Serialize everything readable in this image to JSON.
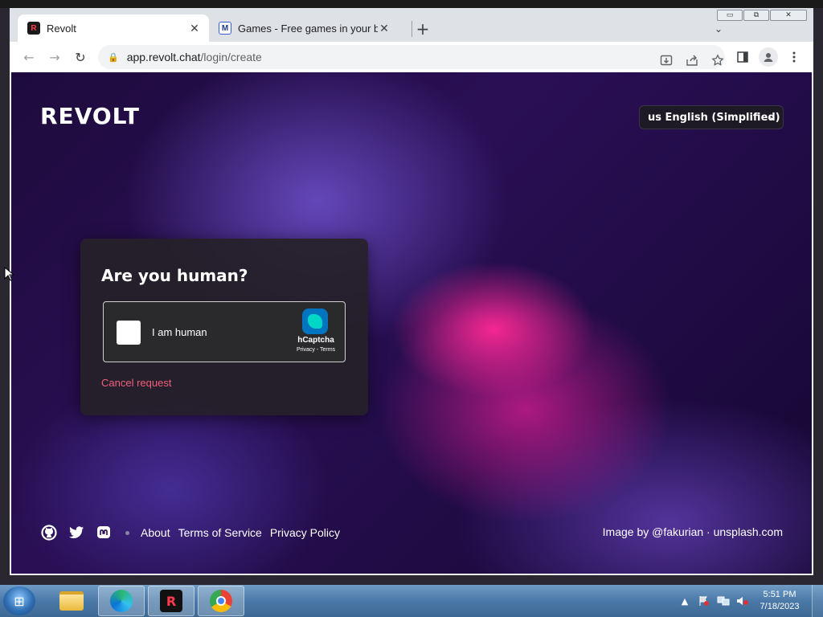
{
  "browser": {
    "window_controls": {
      "minimize": "▭",
      "restore": "⧉",
      "close": "✕"
    },
    "tabs": [
      {
        "favicon": "R",
        "title": "Revolt",
        "close": "✕",
        "active": true
      },
      {
        "favicon": "M",
        "title": "Games - Free games in your brow",
        "close": "✕",
        "active": false
      }
    ],
    "new_tab": "+",
    "tab_menu": "⌄",
    "nav": {
      "back": "←",
      "forward": "→",
      "reload": "↻"
    },
    "address": {
      "lock": "🔒",
      "host": "app.revolt.chat",
      "path": "/login/create"
    }
  },
  "page": {
    "logo": "REVOLT",
    "language": {
      "flag": "us",
      "selected": "English (Simplified)",
      "chevron": "⌄"
    },
    "captcha_card": {
      "title": "Are you human?",
      "checkbox_label": "I am human",
      "brand": "hCaptcha",
      "terms": "Privacy - Terms",
      "cancel": "Cancel request"
    },
    "footer": {
      "icons": [
        "github-icon",
        "twitter-icon",
        "mastodon-icon"
      ],
      "links": [
        "About",
        "Terms of Service",
        "Privacy Policy"
      ],
      "credit": "Image by @fakurian · unsplash.com"
    }
  },
  "taskbar": {
    "apps": [
      "windows-explorer",
      "edge",
      "revolt",
      "chrome"
    ],
    "clock": {
      "time": "5:51 PM",
      "date": "7/18/2023"
    },
    "tray_arrow": "▲"
  },
  "colors": {
    "accent": "#f2607a",
    "background": "#2a0f55",
    "pink": "#ff2896"
  }
}
